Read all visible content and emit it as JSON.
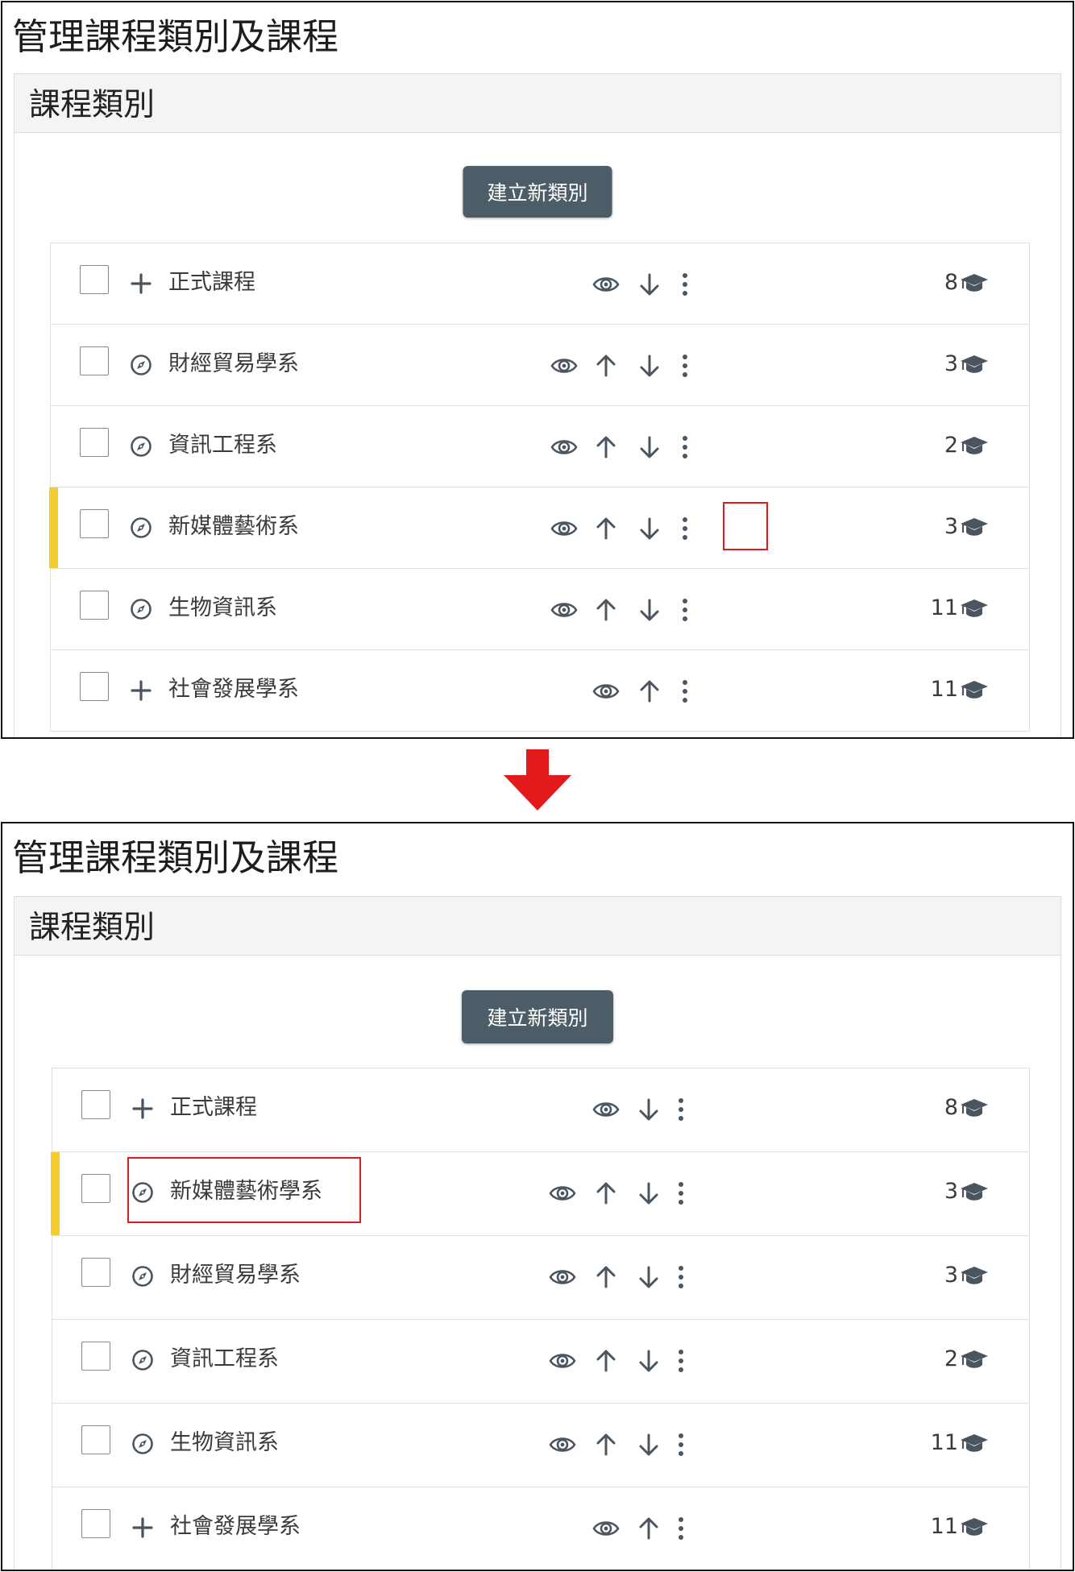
{
  "before": {
    "page_title": "管理課程類別及課程",
    "card_title": "課程類別",
    "create_button": "建立新類別",
    "rows": [
      {
        "name": "正式課程",
        "count": "8",
        "icon": "plus-icon",
        "eye": true,
        "up": false,
        "down": true,
        "highlight": false
      },
      {
        "name": "財經貿易學系",
        "count": "3",
        "icon": "compass-icon",
        "eye": true,
        "up": true,
        "down": true,
        "highlight": false
      },
      {
        "name": "資訊工程系",
        "count": "2",
        "icon": "compass-icon",
        "eye": true,
        "up": true,
        "down": true,
        "highlight": false
      },
      {
        "name": "新媒體藝術系",
        "count": "3",
        "icon": "compass-icon",
        "eye": true,
        "up": true,
        "down": true,
        "highlight": true
      },
      {
        "name": "生物資訊系",
        "count": "11",
        "icon": "compass-icon",
        "eye": true,
        "up": true,
        "down": true,
        "highlight": false
      },
      {
        "name": "社會發展學系",
        "count": "11",
        "icon": "plus-icon",
        "eye": true,
        "up": true,
        "down": false,
        "highlight": false
      }
    ]
  },
  "after": {
    "page_title": "管理課程類別及課程",
    "card_title": "課程類別",
    "create_button": "建立新類別",
    "rows": [
      {
        "name": "正式課程",
        "count": "8",
        "icon": "plus-icon",
        "eye": true,
        "up": false,
        "down": true,
        "highlight": false
      },
      {
        "name": "新媒體藝術學系",
        "count": "3",
        "icon": "compass-icon",
        "eye": true,
        "up": true,
        "down": true,
        "highlight": true
      },
      {
        "name": "財經貿易學系",
        "count": "3",
        "icon": "compass-icon",
        "eye": true,
        "up": true,
        "down": true,
        "highlight": false
      },
      {
        "name": "資訊工程系",
        "count": "2",
        "icon": "compass-icon",
        "eye": true,
        "up": true,
        "down": true,
        "highlight": false
      },
      {
        "name": "生物資訊系",
        "count": "11",
        "icon": "compass-icon",
        "eye": true,
        "up": true,
        "down": true,
        "highlight": false
      },
      {
        "name": "社會發展學系",
        "count": "11",
        "icon": "plus-icon",
        "eye": true,
        "up": true,
        "down": false,
        "highlight": false
      }
    ]
  },
  "colors": {
    "button_bg": "#4d5d68",
    "highlight_bar": "#f5cd2f",
    "annotation_red": "#e0191e",
    "icon_gray": "#4a5560"
  }
}
